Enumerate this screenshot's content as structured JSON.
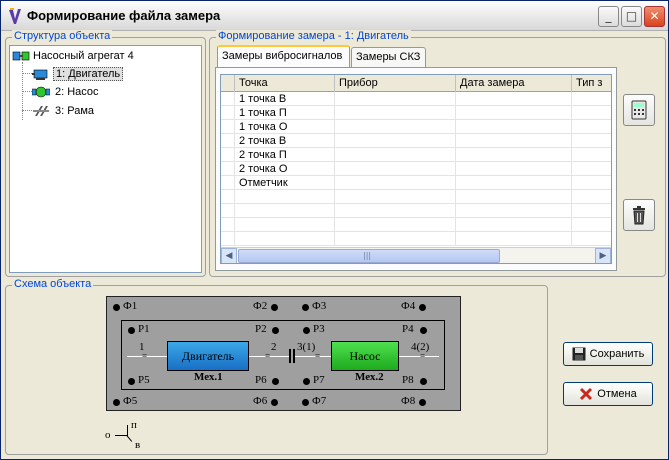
{
  "window": {
    "title": "Формирование файла замера"
  },
  "structure": {
    "label": "Структура объекта",
    "root": "Насосный агрегат 4",
    "items": [
      {
        "label": "1: Двигатель",
        "icon": "motor-icon",
        "selected": true
      },
      {
        "label": "2: Насос",
        "icon": "pump-icon",
        "selected": false
      },
      {
        "label": "3: Рама",
        "icon": "frame-icon",
        "selected": false
      }
    ]
  },
  "measurement": {
    "label": "Формирование замера - 1: Двигатель",
    "tabs": [
      "Замеры вибросигналов",
      "Замеры СКЗ"
    ],
    "columns": [
      "Точка",
      "Прибор",
      "Дата замера",
      "Тип з"
    ],
    "rows": [
      [
        "1 точка В",
        "",
        "",
        ""
      ],
      [
        "1 точка П",
        "",
        "",
        ""
      ],
      [
        "1 точка О",
        "",
        "",
        ""
      ],
      [
        "2 точка В",
        "",
        "",
        ""
      ],
      [
        "2 точка П",
        "",
        "",
        ""
      ],
      [
        "2 точка О",
        "",
        "",
        ""
      ],
      [
        "Отметчик",
        "",
        "",
        ""
      ]
    ]
  },
  "schema": {
    "label": "Схема объекта",
    "top_labels": [
      "Ф1",
      "Ф2",
      "Ф3",
      "Ф4"
    ],
    "p_top_labels": [
      "P1",
      "P2",
      "P3",
      "P4"
    ],
    "p_bottom_labels": [
      "P5",
      "P6",
      "P7",
      "P8"
    ],
    "bottom_labels": [
      "Ф5",
      "Ф6",
      "Ф7",
      "Ф8"
    ],
    "motor": {
      "name": "Двигатель",
      "caption": "Мех.1",
      "left_point": "1",
      "right_point": "2"
    },
    "pump": {
      "name": "Насос",
      "caption": "Мех.2",
      "left_point": "3(1)",
      "right_point": "4(2)"
    },
    "legend": {
      "o": "о",
      "p": "п",
      "v": "в"
    }
  },
  "buttons": {
    "save": "Сохранить",
    "cancel": "Отмена"
  },
  "colors": {
    "group_label": "#0046d5",
    "motor": "#2a8ad8",
    "pump": "#2ec82e"
  }
}
